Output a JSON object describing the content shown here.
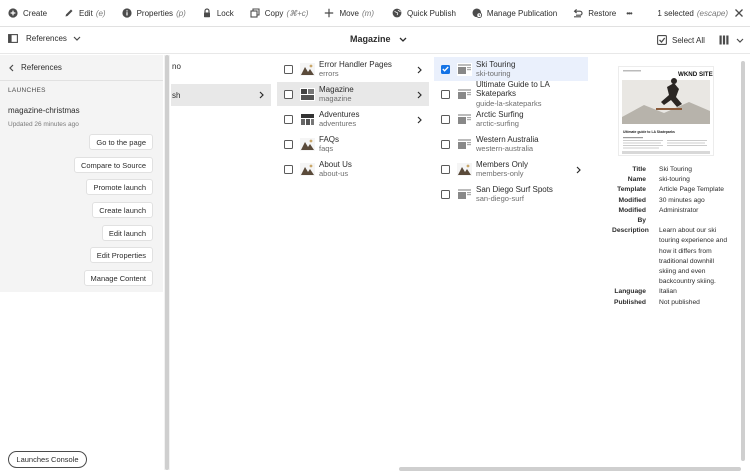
{
  "actionbar": {
    "create": "Create",
    "edit": "Edit",
    "edit_kb": "(e)",
    "properties": "Properties",
    "properties_kb": "(p)",
    "lock": "Lock",
    "copy": "Copy",
    "copy_kb": "(⌘+c)",
    "move": "Move",
    "move_kb": "(m)",
    "quick_publish": "Quick Publish",
    "manage_publication": "Manage Publication",
    "restore": "Restore",
    "more": "•••",
    "selected_count": "1 selected",
    "selected_kb": "(escape)"
  },
  "header": {
    "rail_label": "References",
    "title": "Magazine",
    "select_all": "Select All"
  },
  "rail": {
    "back_label": "References",
    "section": "LAUNCHES",
    "launch_name": "magazine-christmas",
    "launch_updated": "Updated 26 minutes ago",
    "buttons": [
      "Go to the page",
      "Compare to Source",
      "Promote launch",
      "Create launch",
      "Edit launch",
      "Edit Properties",
      "Manage Content"
    ],
    "console_button": "Launches Console"
  },
  "col1": [
    {
      "label": "no"
    },
    {
      "label": "sh"
    }
  ],
  "col2": [
    {
      "title": "Error Handler Pages",
      "name": "errors"
    },
    {
      "title": "Magazine",
      "name": "magazine"
    },
    {
      "title": "Adventures",
      "name": "adventures"
    },
    {
      "title": "FAQs",
      "name": "faqs"
    },
    {
      "title": "About Us",
      "name": "about-us"
    }
  ],
  "col3": [
    {
      "title": "Ski Touring",
      "name": "ski-touring"
    },
    {
      "title": "Ultimate Guide to LA Skateparks",
      "name": "guide-la-skateparks"
    },
    {
      "title": "Arctic Surfing",
      "name": "arctic-surfing"
    },
    {
      "title": "Western Australia",
      "name": "western-australia"
    },
    {
      "title": "Members Only",
      "name": "members-only"
    },
    {
      "title": "San Diego Surf Spots",
      "name": "san-diego-surf"
    }
  ],
  "preview": {
    "site_label": "WKND SITE",
    "caption": "Ultimate guide to LA Skateparks"
  },
  "meta": {
    "title_k": "Title",
    "title_v": "Ski Touring",
    "name_k": "Name",
    "name_v": "ski-touring",
    "template_k": "Template",
    "template_v": "Article Page Template",
    "modified_k": "Modified",
    "modified_v": "30 minutes ago",
    "modified_by_k": "Modified By",
    "modified_by_v": "Administrator",
    "description_k": "Description",
    "description_v": "Learn about our ski touring experience and how it differs from traditional downhill skiing and even backcountry skiing.",
    "language_k": "Language",
    "language_v": "Italian",
    "published_k": "Published",
    "published_v": "Not published"
  },
  "colors": {
    "accent": "#1473e6",
    "selected_row": "#eaf0fc",
    "active_row": "#e8e8e8",
    "rail_bg": "#f4f4f4"
  }
}
